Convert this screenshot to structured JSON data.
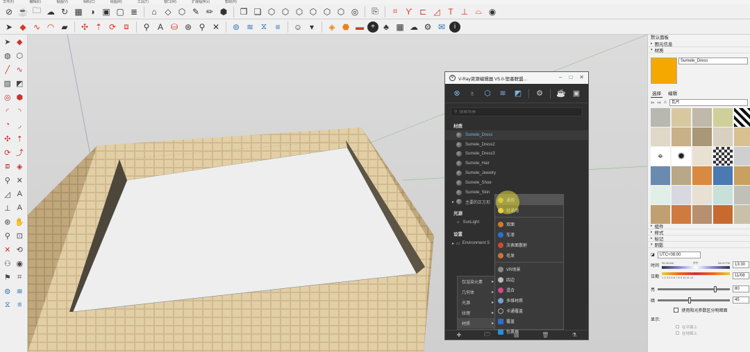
{
  "menubar": {
    "items": [
      "文件(F)",
      "编辑(E)",
      "视图(V)",
      "相机(C)",
      "绘图(R)",
      "工具(T)",
      "窗口(W)",
      "扩展程序(x)",
      "帮助(H)"
    ]
  },
  "vray_editor": {
    "title": "V-Ray资源编辑器 V5.0-塑墨联盟...",
    "search_placeholder": "搜索场景",
    "sections": {
      "materials_label": "材质",
      "lights_label": "光源",
      "settings_label": "设置"
    },
    "materials": [
      "Sumele_Dress",
      "Sumele_Dress2",
      "Sumele_Dress3",
      "Sumele_Hair",
      "Sumele_Jewelry",
      "Sumele_Shoe",
      "Sumele_Skin",
      "主要的正方形"
    ],
    "selected_material": "Sumele_Dress",
    "lights": [
      "SunLight"
    ],
    "settings": [
      "Environment S"
    ]
  },
  "context_menu_left": {
    "items": [
      "仅渲染元素",
      "几何体",
      "光源",
      "纹理",
      "材质"
    ]
  },
  "context_menu_right": {
    "items": [
      "通用",
      "轻通用",
      "双面",
      "车漆",
      "次表面散射",
      "毛发",
      "VR场景",
      "四边",
      "混合",
      "多维材质",
      "卡通覆盖",
      "覆盖",
      "包裹器"
    ]
  },
  "right_panel": {
    "default_tray": "默认面板",
    "entity_info": "图元信息",
    "materials_tray": "材质",
    "material_name": "Sumele_Dress",
    "swatch_color": "#f5a800",
    "tab_select": "选择",
    "tab_edit": "编辑",
    "library": "瓦片",
    "trays_collapsed": [
      "组件",
      "样式",
      "标记"
    ],
    "shadows_tray": "阴影",
    "timezone": "UTC+08:00",
    "time_label": "时间",
    "time_am": "06:46 AM",
    "time_noon": "中午",
    "time_pm": "06:00 PM",
    "time_value": "13:30",
    "date_label": "日期",
    "months": "1 2 3 4 5 6 7 8 9 10 11 12",
    "date_value": "11/08",
    "light_label": "亮",
    "light_value": "80",
    "dark_label": "暗",
    "dark_value": "45",
    "sun_shading_label": "使用阳光参数区分明暗面",
    "display_label": "显示:",
    "on_faces": "在平面上",
    "on_ground": "在地面上"
  },
  "colors": {
    "accent_orange": "#f5a800",
    "vray_bg": "#2f2f2f",
    "vray_highlight": "#6fb3ef"
  }
}
